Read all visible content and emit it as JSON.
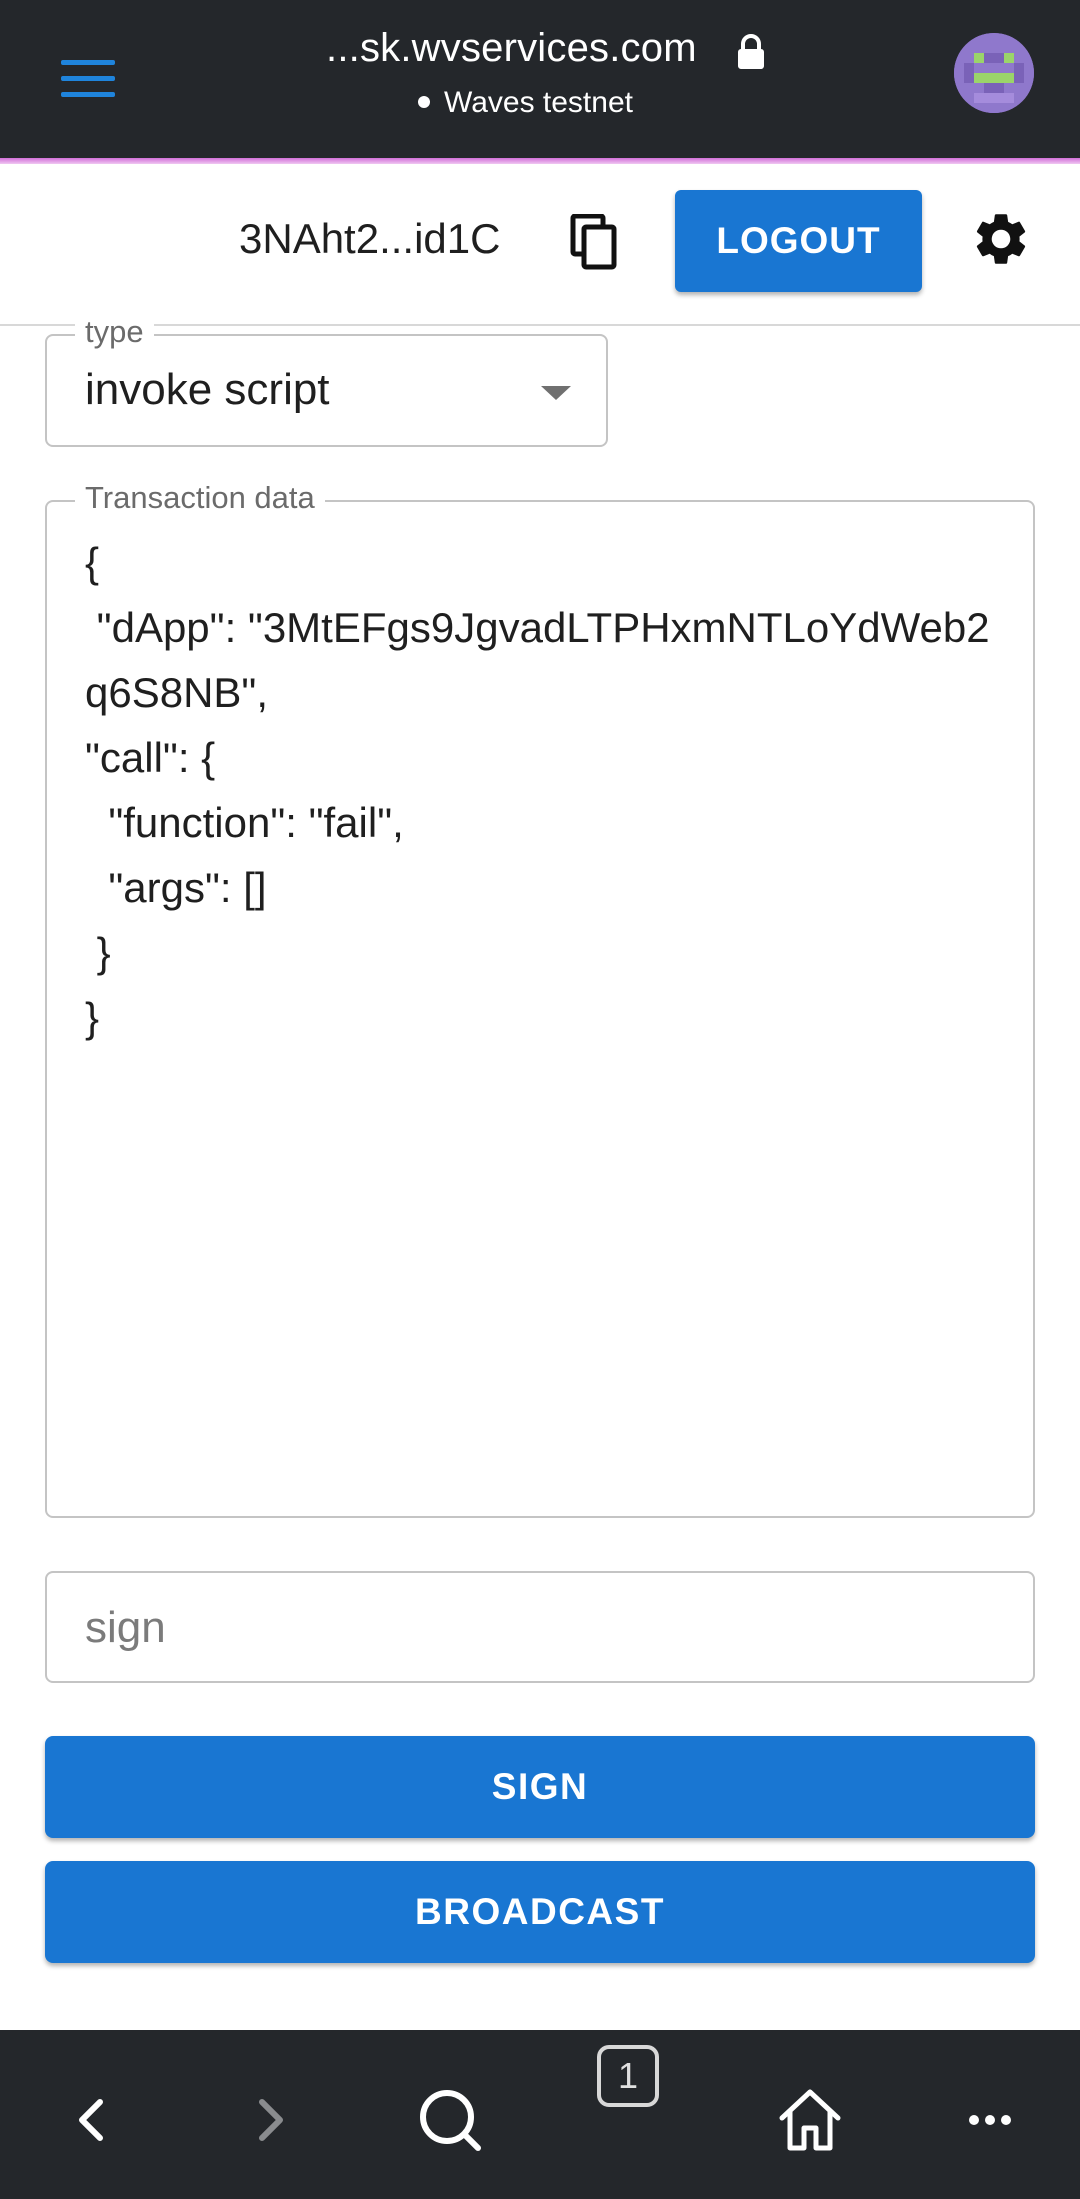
{
  "browser": {
    "url": "...sk.wvservices.com",
    "network": "Waves testnet"
  },
  "header": {
    "address": "3NAht2...id1C",
    "logout_label": "LOGOUT"
  },
  "form": {
    "type_legend": "type",
    "type_value": "invoke script",
    "tx_legend": "Transaction data",
    "tx_value": "{\n \"dApp\": \"3MtEFgs9JgvadLTPHxmNTLoYdWeb2q6S8NB\",\n\"call\": {\n  \"function\": \"fail\",\n  \"args\": []\n }\n}",
    "sign_placeholder": "sign",
    "sign_label": "SIGN",
    "broadcast_label": "BROADCAST"
  },
  "bottom_nav": {
    "tabs_count": "1"
  },
  "colors": {
    "primary": "#1976d2",
    "bar": "#24272b",
    "menu_icon": "#1f84dc"
  }
}
